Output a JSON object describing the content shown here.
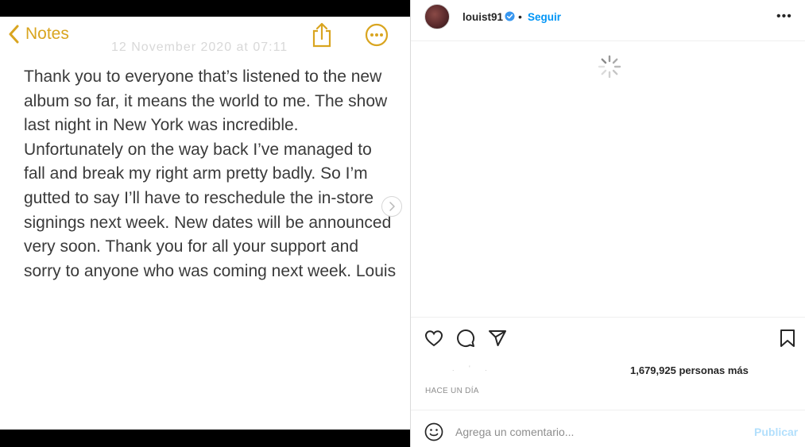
{
  "notes": {
    "back_label": "Notes",
    "date_faint": "12 November 2020 at 07:11",
    "body": "Thank you to everyone that’s listened to the new album so far, it means the world to me. The show last night in New York was incredible. Unfortunately on the way back I’ve managed to fall and break my right arm pretty badly. So I’m gutted to say I’ll have to reschedule the in-store signings next week. New dates will be announced very soon. Thank you for all your support and sorry to anyone who was coming next week. Louis",
    "accent_color": "#d9a520"
  },
  "post": {
    "username": "louist91",
    "separator": "•",
    "follow_label": "Seguir",
    "more_label": "•••",
    "likes_faint": ". ' .",
    "likes_text": "1,679,925 personas más",
    "timestamp": "HACE UN DÍA",
    "comment_placeholder": "Agrega un comentario...",
    "publish_label": "Publicar",
    "icons": [
      "heart-icon",
      "comment-icon",
      "share-icon",
      "bookmark-icon",
      "emoji-icon",
      "verified-icon",
      "loading-spinner-icon"
    ]
  },
  "colors": {
    "link_blue": "#0095f6",
    "publish_disabled": "#b2dffc",
    "border": "#dbdbdb"
  }
}
